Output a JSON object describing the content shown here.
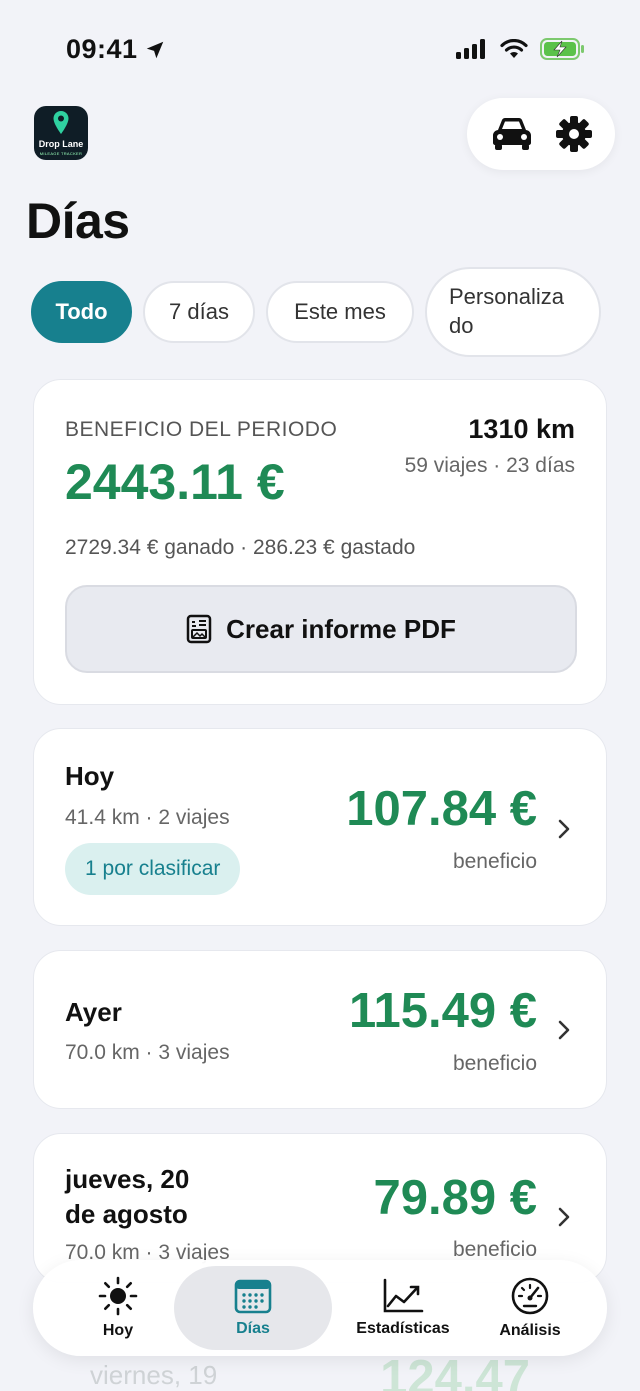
{
  "status_bar": {
    "time": "09:41"
  },
  "header": {
    "app_logo_text": "Drop Lane",
    "app_logo_sub": "MILEAGE TRACKER",
    "title": "Días"
  },
  "filters": [
    {
      "label": "Todo",
      "active": true
    },
    {
      "label": "7 días",
      "active": false
    },
    {
      "label": "Este mes",
      "active": false
    },
    {
      "label": "Personaliza do",
      "active": false
    }
  ],
  "summary": {
    "label": "BENEFICIO DEL PERIODO",
    "value": "2443.11 €",
    "km": "1310 km",
    "trips": "59 viajes · 23 días",
    "detail": "2729.34 € ganado · 286.23 € gastado",
    "pdf_button": "Crear informe PDF"
  },
  "days": [
    {
      "name": "Hoy",
      "meta": "41.4 km · 2 viajes",
      "amount": "107.84 €",
      "amount_label": "beneficio",
      "badge": "1 por clasificar"
    },
    {
      "name": "Ayer",
      "meta": "70.0 km · 3 viajes",
      "amount": "115.49 €",
      "amount_label": "beneficio"
    },
    {
      "name_line1": "jueves, 20",
      "name_line2": "de agosto",
      "meta": "70.0 km · 3 viajes",
      "amount": "79.89 €",
      "amount_label": "beneficio"
    }
  ],
  "behind_tabbar": {
    "day": "viernes, 19",
    "amount": "124.47"
  },
  "tabbar": [
    {
      "label": "Hoy",
      "icon": "sun-icon",
      "active": false
    },
    {
      "label": "Días",
      "icon": "calendar-icon",
      "active": true
    },
    {
      "label": "Estadísticas",
      "icon": "chart-icon",
      "active": false
    },
    {
      "label": "Análisis",
      "icon": "gauge-icon",
      "active": false
    }
  ],
  "colors": {
    "accent": "#17808e",
    "profit": "#1f8a55",
    "background": "#f2f3f8"
  }
}
